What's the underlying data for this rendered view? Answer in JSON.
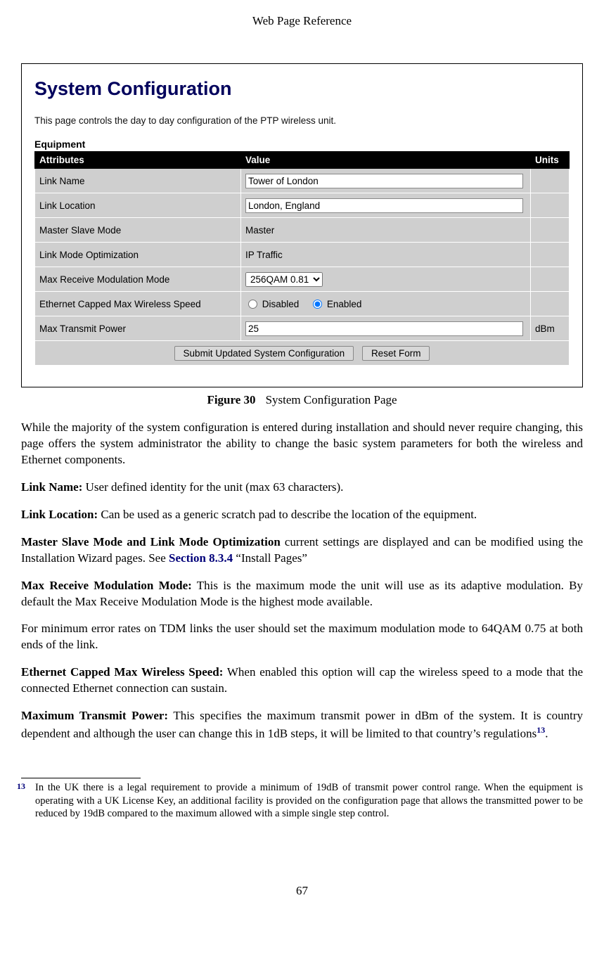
{
  "header": "Web Page Reference",
  "figure": {
    "title": "System Configuration",
    "description": "This page controls the day to day configuration of the PTP wireless unit.",
    "equipment_label": "Equipment",
    "th_attributes": "Attributes",
    "th_value": "Value",
    "th_units": "Units",
    "rows": {
      "link_name": {
        "attr": "Link Name",
        "value": "Tower of London",
        "units": ""
      },
      "link_location": {
        "attr": "Link Location",
        "value": "London, England",
        "units": ""
      },
      "master_slave": {
        "attr": "Master Slave Mode",
        "value": "Master",
        "units": ""
      },
      "link_mode_opt": {
        "attr": "Link Mode Optimization",
        "value": "IP Traffic",
        "units": ""
      },
      "max_rx_mod": {
        "attr": "Max Receive Modulation Mode",
        "value": "256QAM 0.81",
        "units": ""
      },
      "eth_capped": {
        "attr": "Ethernet Capped Max Wireless Speed",
        "disabled_label": "Disabled",
        "enabled_label": "Enabled",
        "selected": "Enabled",
        "units": ""
      },
      "max_tx_power": {
        "attr": "Max Transmit Power",
        "value": "25",
        "units": "dBm"
      }
    },
    "buttons": {
      "submit": "Submit Updated System Configuration",
      "reset": "Reset Form"
    },
    "caption_label": "Figure 30",
    "caption_text": "System Configuration Page"
  },
  "paragraphs": {
    "intro": "While the majority of the system configuration is entered during installation and should never require changing, this page offers the system administrator the ability to change the basic system parameters for both the wireless and Ethernet components.",
    "link_name_term": "Link Name:",
    "link_name_text": " User defined identity for the unit (max 63 characters).",
    "link_location_term": "Link Location:",
    "link_location_text": " Can be used as a generic scratch pad to describe the location of the equipment.",
    "mslm_term": "Master Slave Mode and Link Mode Optimization",
    "mslm_text1": " current settings are displayed and can be modified using the Installation Wizard pages. See ",
    "mslm_xref": "Section 8.3.4",
    "mslm_text2": " “Install Pages”",
    "max_rx_term": "Max Receive Modulation Mode:",
    "max_rx_text": " This is the maximum mode the unit will use as its adaptive modulation. By default the Max Receive Modulation Mode is the highest mode available.",
    "tdm_text": "For minimum error rates on TDM links the user should set the maximum modulation mode to 64QAM 0.75 at both ends of the link.",
    "eth_term": "Ethernet Capped Max Wireless Speed:",
    "eth_text": " When enabled this option will cap the wireless speed to a mode that the connected Ethernet connection can sustain.",
    "maxtx_term": "Maximum Transmit Power:",
    "maxtx_text1": " This specifies the maximum transmit power in dBm of the system. It is country dependent and although the user can change this in 1dB steps, it will be limited to that country’s regulations",
    "maxtx_fn": "13",
    "maxtx_text2": "."
  },
  "footnote": {
    "mark": "13",
    "text": "In the UK there is a legal requirement to provide a minimum of 19dB of transmit power control range. When the equipment is operating with a UK License Key, an additional facility is provided on the configuration page that allows the transmitted power to be reduced by 19dB compared to the maximum allowed with a simple single step control."
  },
  "page_number": "67"
}
